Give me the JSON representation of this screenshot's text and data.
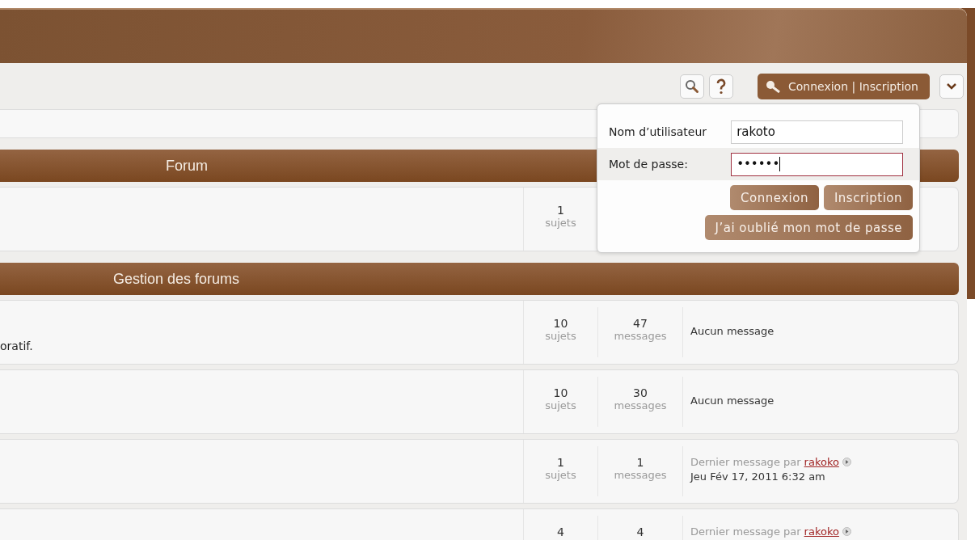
{
  "toolbar": {
    "login_label": "Connexion | Inscription"
  },
  "categories": [
    {
      "title": "Forum",
      "forums": [
        {
          "topics": {
            "count": "1",
            "label": "sujets"
          }
        }
      ]
    },
    {
      "title": "Gestion des forums",
      "forums": [
        {
          "description": "oratif.",
          "topics": {
            "count": "10",
            "label": "sujets"
          },
          "posts": {
            "count": "47",
            "label": "messages"
          },
          "last": {
            "kind": "none",
            "text": "Aucun message"
          }
        },
        {
          "topics": {
            "count": "10",
            "label": "sujets"
          },
          "posts": {
            "count": "30",
            "label": "messages"
          },
          "last": {
            "kind": "none",
            "text": "Aucun message"
          }
        },
        {
          "topics": {
            "count": "1",
            "label": "sujets"
          },
          "posts": {
            "count": "1",
            "label": "messages"
          },
          "last": {
            "kind": "post",
            "prefix": "Dernier message par",
            "author": "rakoko",
            "date": "Jeu Fév 17, 2011 6:32 am"
          }
        },
        {
          "topics": {
            "count": "4"
          },
          "posts": {
            "count": "4"
          },
          "last": {
            "kind": "post",
            "prefix": "Dernier message par",
            "author": "rakoko"
          }
        }
      ]
    }
  ],
  "login_popup": {
    "username_label": "Nom d’utilisateur",
    "username": "rakoto",
    "password_label": "Mot de passe:",
    "password": "••••••",
    "password_focused": true,
    "buttons": [
      "Connexion",
      "Inscription"
    ],
    "forgot": "J’ai oublié mon mot de passe"
  }
}
